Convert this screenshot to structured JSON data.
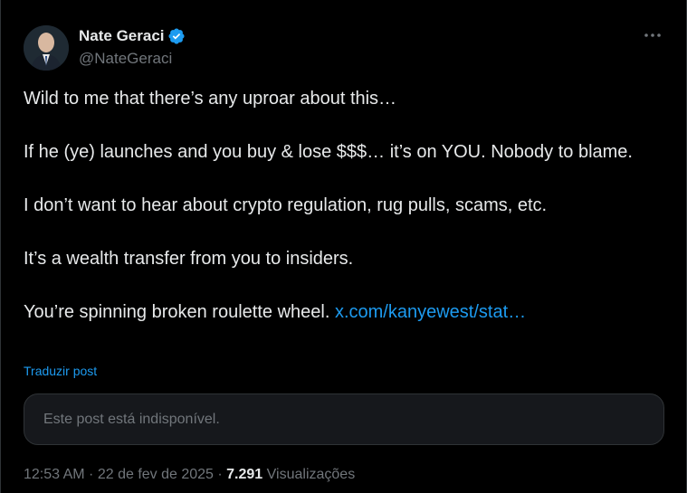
{
  "author": {
    "display_name": "Nate Geraci",
    "handle": "@NateGeraci",
    "verified": true
  },
  "menu": {
    "more_icon": "ellipsis-icon"
  },
  "post": {
    "lines": [
      "Wild to me that there’s any uproar about this…",
      "If he (ye) launches and you buy & lose $$$… it’s on YOU. Nobody to blame.",
      "I don’t want to hear about crypto regulation, rug pulls, scams, etc.",
      "It’s a wealth transfer from you to insiders.",
      "You’re spinning broken roulette wheel."
    ],
    "link_text": "x.com/kanyewest/stat…"
  },
  "translate_label": "Traduzir post",
  "quoted_unavailable": "Este post está indisponível.",
  "meta": {
    "time": "12:53 AM",
    "separator": " · ",
    "date": "22 de fev de 2025",
    "separator2": " · ",
    "views_count": "7.291",
    "views_label": "Visualizações"
  },
  "colors": {
    "accent": "#1d9bf0",
    "background": "#000000",
    "text": "#e7e9ea",
    "muted": "#71767b"
  }
}
